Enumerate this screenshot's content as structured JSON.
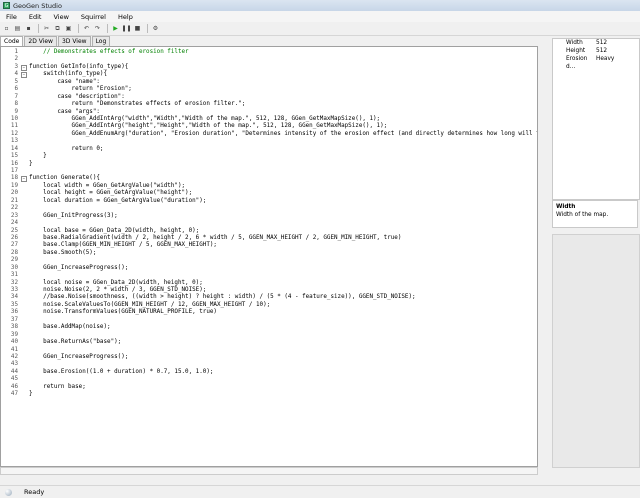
{
  "window": {
    "title": "GeoGen Studio"
  },
  "menu": [
    "File",
    "Edit",
    "View",
    "Squirrel",
    "Help"
  ],
  "tabs": [
    "Code",
    "2D View",
    "3D View",
    "Log"
  ],
  "properties": [
    {
      "key": "Width",
      "value": "512"
    },
    {
      "key": "Height",
      "value": "512"
    },
    {
      "key": "Erosion d...",
      "value": "Heavy"
    }
  ],
  "description": {
    "title": "Width",
    "text": "Width of the map."
  },
  "status": "Ready",
  "code": [
    {
      "n": "1",
      "t": "\t// Demonstrates effects of erosion filter",
      "c": "cm"
    },
    {
      "n": "2",
      "t": ""
    },
    {
      "n": "3",
      "t": "function GetInfo(info_type){",
      "f": "-"
    },
    {
      "n": "4",
      "t": "\tswitch(info_type){",
      "f": "-"
    },
    {
      "n": "5",
      "t": "\t\tcase \"name\":"
    },
    {
      "n": "6",
      "t": "\t\t\treturn \"Erosion\";"
    },
    {
      "n": "7",
      "t": "\t\tcase \"description\":"
    },
    {
      "n": "8",
      "t": "\t\t\treturn \"Demonstrates effects of erosion filter.\";"
    },
    {
      "n": "9",
      "t": "\t\tcase \"args\":"
    },
    {
      "n": "10",
      "t": "\t\t\tGGen_AddIntArg(\"width\",\"Width\",\"Width of the map.\", 512, 128, GGen_GetMaxMapSize(), 1);"
    },
    {
      "n": "11",
      "t": "\t\t\tGGen_AddIntArg(\"height\",\"Height\",\"Width of the map.\", 512, 128, GGen_GetMaxMapSize(), 1);"
    },
    {
      "n": "12",
      "t": "\t\t\tGGen_AddEnumArg(\"duration\", \"Erosion duration\", \"Determines intensity of the erosion effect (and directly determines how long will t"
    },
    {
      "n": "13",
      "t": ""
    },
    {
      "n": "14",
      "t": "\t\t\treturn 0;"
    },
    {
      "n": "15",
      "t": "\t}"
    },
    {
      "n": "16",
      "t": "}"
    },
    {
      "n": "17",
      "t": ""
    },
    {
      "n": "18",
      "t": "function Generate(){",
      "f": "-"
    },
    {
      "n": "19",
      "t": "\tlocal width = GGen_GetArgValue(\"width\");"
    },
    {
      "n": "20",
      "t": "\tlocal height = GGen_GetArgValue(\"height\");"
    },
    {
      "n": "21",
      "t": "\tlocal duration = GGen_GetArgValue(\"duration\");"
    },
    {
      "n": "22",
      "t": ""
    },
    {
      "n": "23",
      "t": "\tGGen_InitProgress(3);"
    },
    {
      "n": "24",
      "t": ""
    },
    {
      "n": "25",
      "t": "\tlocal base = GGen_Data_2D(width, height, 0);"
    },
    {
      "n": "26",
      "t": "\tbase.RadialGradient(width / 2, height / 2, 6 * width / 5, GGEN_MAX_HEIGHT / 2, GGEN_MIN_HEIGHT, true)"
    },
    {
      "n": "27",
      "t": "\tbase.Clamp(GGEN_MIN_HEIGHT / 5, GGEN_MAX_HEIGHT);"
    },
    {
      "n": "28",
      "t": "\tbase.Smooth(5);"
    },
    {
      "n": "29",
      "t": ""
    },
    {
      "n": "30",
      "t": "\tGGen_IncreaseProgress();"
    },
    {
      "n": "31",
      "t": ""
    },
    {
      "n": "32",
      "t": "\tlocal noise = GGen_Data_2D(width, height, 0);"
    },
    {
      "n": "33",
      "t": "\tnoise.Noise(2, 2 * width / 3, GGEN_STD_NOISE);"
    },
    {
      "n": "34",
      "t": "\t//base.Noise(smoothness, ((width > height) ? height : width) / (5 * (4 - feature_size)), GGEN_STD_NOISE);"
    },
    {
      "n": "35",
      "t": "\tnoise.ScaleValuesTo(GGEN_MIN_HEIGHT / 12, GGEN_MAX_HEIGHT / 10);"
    },
    {
      "n": "36",
      "t": "\tnoise.TransformValues(GGEN_NATURAL_PROFILE, true)"
    },
    {
      "n": "37",
      "t": ""
    },
    {
      "n": "38",
      "t": "\tbase.AddMap(noise);"
    },
    {
      "n": "39",
      "t": ""
    },
    {
      "n": "40",
      "t": "\tbase.ReturnAs(\"base\");"
    },
    {
      "n": "41",
      "t": ""
    },
    {
      "n": "42",
      "t": "\tGGen_IncreaseProgress();"
    },
    {
      "n": "43",
      "t": ""
    },
    {
      "n": "44",
      "t": "\tbase.Erosion((1.0 + duration) * 0.7, 15.0, 1.0);"
    },
    {
      "n": "45",
      "t": ""
    },
    {
      "n": "46",
      "t": "\treturn base;"
    },
    {
      "n": "47",
      "t": "}"
    }
  ]
}
